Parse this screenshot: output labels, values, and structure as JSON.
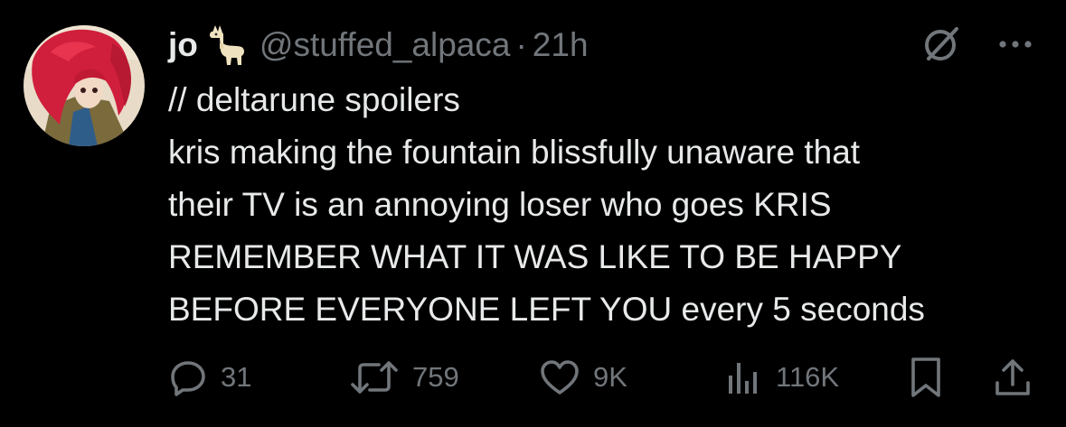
{
  "tweet": {
    "display_name": "jo",
    "name_emoji": "llama-emoji",
    "handle": "@stuffed_alpaca",
    "separator": "·",
    "time": "21h",
    "lines": [
      "// deltarune spoilers",
      "kris making the fountain blissfully unaware that",
      "their TV is an annoying loser who goes KRIS",
      "REMEMBER WHAT IT WAS LIKE TO BE HAPPY",
      "BEFORE EVERYONE LEFT YOU every 5 seconds"
    ]
  },
  "actions": {
    "replies": "31",
    "reposts": "759",
    "likes": "9K",
    "views": "116K"
  },
  "icons": {
    "header": [
      "grok-icon",
      "more-icon"
    ],
    "actions": [
      "reply-icon",
      "repost-icon",
      "like-icon",
      "views-icon",
      "bookmark-icon",
      "share-icon"
    ]
  },
  "colors": {
    "background": "#000000",
    "primary_text": "#e7e9ea",
    "secondary_text": "#71767b"
  }
}
